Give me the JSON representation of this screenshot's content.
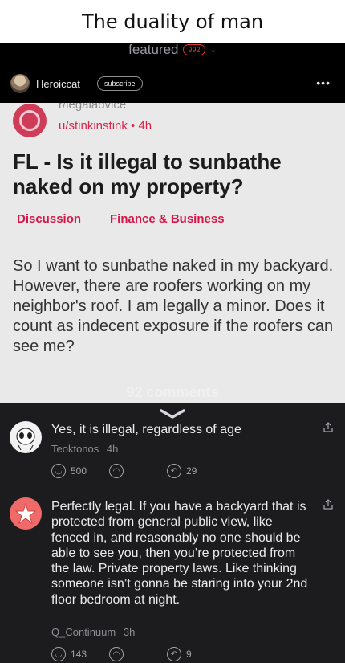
{
  "meme_title": "The duality of man",
  "featured": {
    "label": "featured",
    "count": "992"
  },
  "user_bar": {
    "username": "Heroiccat",
    "subscribe_label": "subscribe"
  },
  "post": {
    "subreddit": "r/legaladvice",
    "meta": "u/stinkinstink • 4h",
    "title": "FL - Is it illegal to sunbathe naked on my property?",
    "flairs": [
      "Discussion",
      "Finance & Business"
    ],
    "body": "So I want to sunbathe naked in my backyard. However, there are roofers working on my neighbor's roof. I am legally a minor. Does it count as indecent exposure if the roofers can see me?"
  },
  "comments_header": "92 comments",
  "comments": [
    {
      "text": "Yes, it is illegal, regardless of age",
      "author": "Teoktonos",
      "time": "4h",
      "upvotes": "500",
      "replies": "29"
    },
    {
      "text": "Perfectly legal. If you have a backyard that is protected from general public view, like fenced in, and reasonably no one should be able to see you, then you’re protected from the law. Private property laws. Like thinking someone isn’t gonna be staring into your 2nd floor bedroom at night.",
      "author": "Q_Continuum",
      "time": "3h",
      "upvotes": "143",
      "replies": "9"
    }
  ],
  "colors": {
    "accent_red": "#e3342f",
    "flair_pink": "#d6154a",
    "background": "#1c1c1e"
  }
}
